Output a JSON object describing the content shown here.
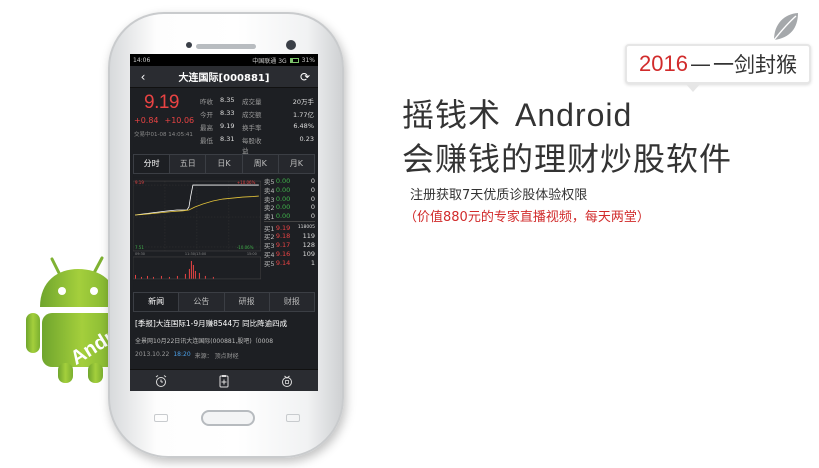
{
  "promo": {
    "badge_year": "2016",
    "badge_dash": "—",
    "badge_text": "一剑封猴",
    "headline_cn": "摇钱术",
    "headline_en": "Android",
    "subheadline": "会赚钱的理财炒股软件",
    "line1": "注册获取7天优质诊股体验权限",
    "line2": "（价值880元的专家直播视频，每天两堂）",
    "robot_text": "Andro"
  },
  "status_bar": {
    "time": "14:06",
    "carrier": "中国联通 3G",
    "battery": "31%"
  },
  "header": {
    "title": "大连国际[000881]"
  },
  "quote": {
    "price": "9.19",
    "change": "+0.84",
    "change_pct": "+10.06",
    "timestamp": "交易中01-08 14:05:41",
    "metrics": [
      {
        "label": "昨收",
        "value": "8.35",
        "label2": "成交量",
        "value2": "20万手"
      },
      {
        "label": "今开",
        "value": "8.33",
        "label2": "成交额",
        "value2": "1.77亿"
      },
      {
        "label": "最高",
        "value": "9.19",
        "label2": "换手率",
        "value2": "6.48%"
      },
      {
        "label": "最低",
        "value": "8.31",
        "label2": "每股收益",
        "value2": "0.23"
      }
    ]
  },
  "chart_tabs": [
    "分时",
    "五日",
    "日K",
    "周K",
    "月K"
  ],
  "chart": {
    "top_left": "9.19",
    "top_right": "+10.06%",
    "bottom_left": "7.51",
    "bottom_right": "-10.06%",
    "t_start": "09:30",
    "t_mid": "11:30/13:00",
    "t_end": "15:00"
  },
  "order_book": {
    "asks": [
      {
        "label": "卖5",
        "price": "0.00",
        "vol": "0"
      },
      {
        "label": "卖4",
        "price": "0.00",
        "vol": "0"
      },
      {
        "label": "卖3",
        "price": "0.00",
        "vol": "0"
      },
      {
        "label": "卖2",
        "price": "0.00",
        "vol": "0"
      },
      {
        "label": "卖1",
        "price": "0.00",
        "vol": "0"
      }
    ],
    "bids": [
      {
        "label": "买1",
        "price": "9.19",
        "vol": "118005"
      },
      {
        "label": "买2",
        "price": "9.18",
        "vol": "119"
      },
      {
        "label": "买3",
        "price": "9.17",
        "vol": "128"
      },
      {
        "label": "买4",
        "price": "9.16",
        "vol": "109"
      },
      {
        "label": "买5",
        "price": "9.14",
        "vol": "1"
      }
    ]
  },
  "news_tabs": [
    "新闻",
    "公告",
    "研报",
    "财报"
  ],
  "news": {
    "headline": "[季报]大连国际1-9月赚8544万 同比降逾四成",
    "body": "全景网10月22日讯大连国际(000881,股吧)（0008",
    "date": "2013.10.22",
    "time": "18:20",
    "source": "来源：  顶点财经"
  },
  "colors": {
    "up": "#e84343",
    "down": "#3fb24a",
    "accent_red": "#d12b2b",
    "screen_bg": "#1d1f23"
  }
}
